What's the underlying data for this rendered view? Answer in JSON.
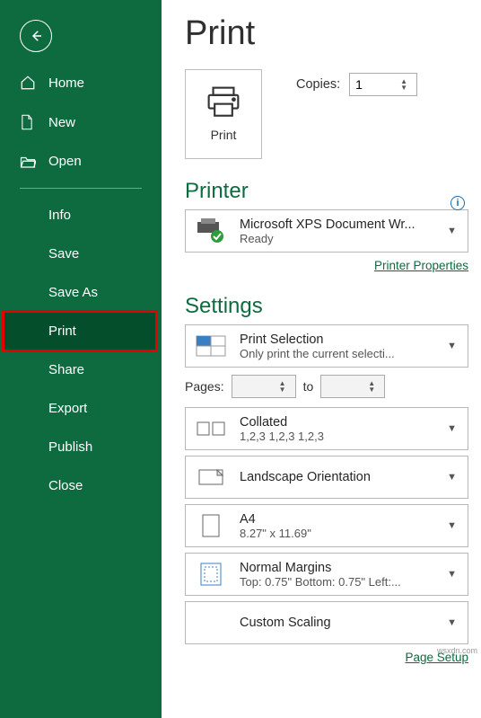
{
  "sidebar": {
    "home": "Home",
    "new": "New",
    "open": "Open",
    "info": "Info",
    "save": "Save",
    "saveAs": "Save As",
    "print": "Print",
    "share": "Share",
    "export": "Export",
    "publish": "Publish",
    "close": "Close"
  },
  "main": {
    "title": "Print",
    "printButton": "Print",
    "copiesLabel": "Copies:",
    "copiesValue": "1",
    "printerHeading": "Printer",
    "printer": {
      "name": "Microsoft XPS Document Wr...",
      "status": "Ready"
    },
    "printerProps": "Printer Properties",
    "settingsHeading": "Settings",
    "printSel": {
      "title": "Print Selection",
      "sub": "Only print the current selecti..."
    },
    "pagesLabel": "Pages:",
    "pagesFrom": "",
    "toLabel": "to",
    "pagesTo": "",
    "collated": {
      "title": "Collated",
      "sub": "1,2,3    1,2,3    1,2,3"
    },
    "orientation": {
      "title": "Landscape Orientation"
    },
    "paper": {
      "title": "A4",
      "sub": "8.27\" x 11.69\""
    },
    "margins": {
      "title": "Normal Margins",
      "sub": "Top: 0.75\" Bottom: 0.75\" Left:..."
    },
    "scaling": {
      "title": "Custom Scaling"
    },
    "pageSetup": "Page Setup",
    "watermark": "wsxdn.com"
  }
}
